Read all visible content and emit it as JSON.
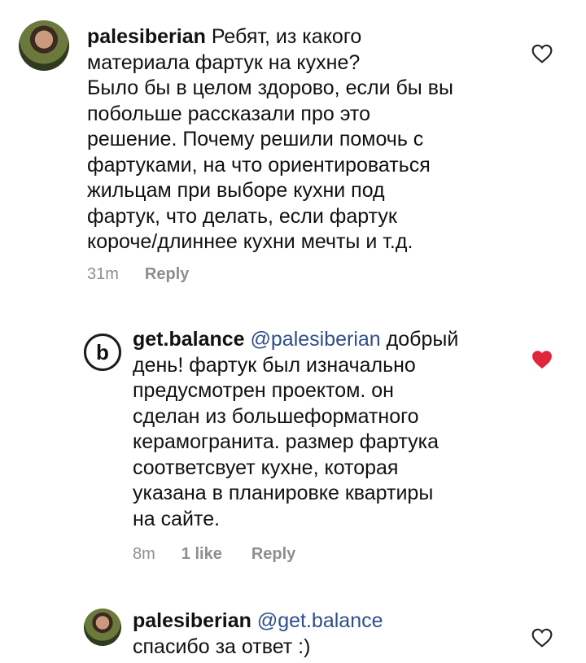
{
  "comments": [
    {
      "username": "palesiberian",
      "lines": [
        "Ребят, из какого",
        "материала фартук на кухне?",
        "Было бы в целом здорово, если бы вы",
        "побольше рассказали про это",
        "решение. Почему решили помочь с",
        "фартуками, на что ориентироваться",
        "жильцам при выборе кухни под",
        "фартук, что делать, если фартук",
        "короче/длиннее кухни мечты и т.д."
      ],
      "time": "31m",
      "reply_label": "Reply",
      "liked": false
    },
    {
      "username": "get.balance",
      "mention": "@palesiberian",
      "first_line_rest": "добрый",
      "lines": [
        "день! фартук был изначально",
        "предусмотрен проектом. он",
        "сделан из большеформатного",
        "керамогранита. размер фартука",
        "соответсвует кухне, которая",
        "указана в планировке квартиры",
        "на сайте."
      ],
      "time": "8m",
      "likes_label": "1 like",
      "reply_label": "Reply",
      "liked": true,
      "avatar_letter": "b"
    },
    {
      "username": "palesiberian",
      "mention": "@get.balance",
      "lines": [
        "спасибо за ответ :)"
      ],
      "liked": false
    }
  ],
  "colors": {
    "mention": "#2f4e8a",
    "heart_liked": "#e0263b",
    "meta": "#8e8e8e"
  },
  "icons": {
    "like": "heart-outline-icon",
    "liked": "heart-filled-icon"
  }
}
